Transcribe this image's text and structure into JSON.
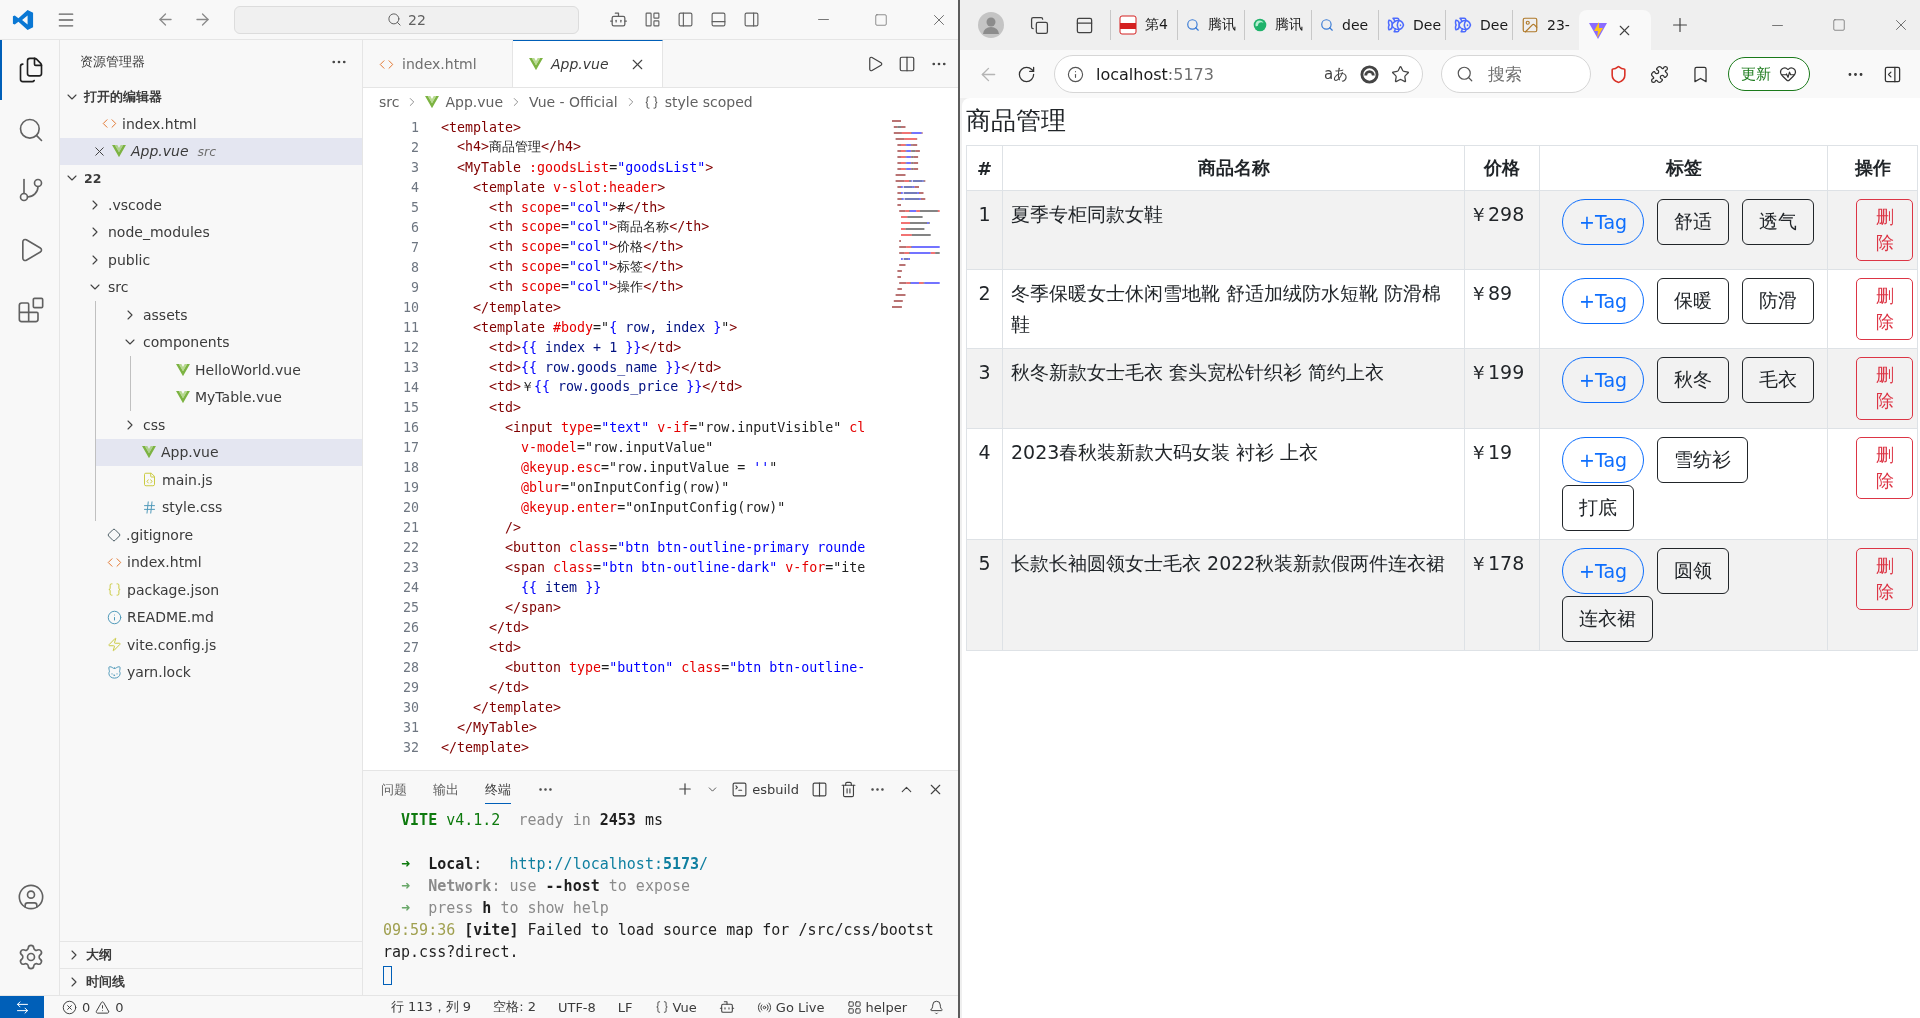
{
  "vscode": {
    "title_bar": {
      "search": "22"
    },
    "activity_bar": [
      {
        "kind": "explorer",
        "selected": true
      },
      {
        "kind": "search",
        "selected": false
      },
      {
        "kind": "source_control",
        "selected": false
      },
      {
        "kind": "run",
        "selected": false
      },
      {
        "kind": "extensions",
        "selected": false
      }
    ],
    "activity_bar_bottom": [
      {
        "kind": "account"
      },
      {
        "kind": "settings"
      }
    ],
    "sidebar": {
      "title": "资源管理器",
      "open_editors": {
        "label": "打开的编辑器",
        "expanded": true,
        "items": [
          {
            "name": "index.html",
            "kind": "html",
            "selected": false
          },
          {
            "name": "App.vue",
            "kind": "vue",
            "hint": "src",
            "selected": true
          }
        ]
      },
      "folder": {
        "label": "22",
        "expanded": true,
        "children": [
          {
            "name": ".vscode",
            "kind": "folder",
            "expanded": false,
            "selected": false
          },
          {
            "name": "node_modules",
            "kind": "folder",
            "expanded": false,
            "selected": false
          },
          {
            "name": "public",
            "kind": "folder",
            "expanded": false,
            "selected": false
          },
          {
            "name": "src",
            "kind": "folder",
            "expanded": true,
            "selected": false,
            "children": [
              {
                "name": "assets",
                "kind": "folder",
                "expanded": false,
                "selected": false
              },
              {
                "name": "components",
                "kind": "folder",
                "expanded": true,
                "selected": false,
                "children": [
                  {
                    "name": "HelloWorld.vue",
                    "kind": "vue",
                    "selected": false
                  },
                  {
                    "name": "MyTable.vue",
                    "kind": "vue",
                    "selected": false
                  }
                ]
              },
              {
                "name": "css",
                "kind": "folder",
                "expanded": false,
                "selected": false
              },
              {
                "name": "App.vue",
                "kind": "vue",
                "selected": true
              },
              {
                "name": "main.js",
                "kind": "js",
                "selected": false
              },
              {
                "name": "style.css",
                "kind": "css",
                "selected": false
              }
            ]
          },
          {
            "name": ".gitignore",
            "kind": "git",
            "selected": false
          },
          {
            "name": "index.html",
            "kind": "html",
            "selected": false
          },
          {
            "name": "package.json",
            "kind": "json",
            "selected": false
          },
          {
            "name": "README.md",
            "kind": "md",
            "selected": false
          },
          {
            "name": "vite.config.js",
            "kind": "vite",
            "selected": false
          },
          {
            "name": "yarn.lock",
            "kind": "yarn",
            "selected": false
          }
        ]
      },
      "sections": [
        {
          "label": "大纲",
          "expanded": false
        },
        {
          "label": "时间线",
          "expanded": false
        }
      ]
    },
    "tabs": [
      {
        "label": "index.html",
        "kind": "html",
        "selected": false
      },
      {
        "label": "App.vue",
        "kind": "vue",
        "selected": true
      }
    ],
    "breadcrumb": [
      {
        "label": "src",
        "kind": "plain"
      },
      {
        "label": "App.vue",
        "kind": "vue"
      },
      {
        "label": "Vue - Official",
        "kind": "plain"
      },
      {
        "label": "style scoped",
        "kind": "braces"
      }
    ],
    "code": [
      {
        "n": "1",
        "segs": [
          {
            "kind": "tag",
            "text": "<template>"
          }
        ]
      },
      {
        "n": "2",
        "segs": [
          {
            "kind": "tag",
            "text": "  <h4>"
          },
          {
            "kind": "text",
            "text": "商品管理"
          },
          {
            "kind": "tag",
            "text": "</h4>"
          }
        ]
      },
      {
        "n": "3",
        "segs": [
          {
            "kind": "tag",
            "text": "  <MyTable "
          },
          {
            "kind": "attr",
            "text": ":goodsList"
          },
          {
            "kind": "text",
            "text": "="
          },
          {
            "kind": "str",
            "text": "\"goodsList\""
          },
          {
            "kind": "tag",
            "text": ">"
          }
        ]
      },
      {
        "n": "4",
        "segs": [
          {
            "kind": "tag",
            "text": "    <template "
          },
          {
            "kind": "attr",
            "text": "v-slot:header"
          },
          {
            "kind": "tag",
            "text": ">"
          }
        ]
      },
      {
        "n": "5",
        "segs": [
          {
            "kind": "tag",
            "text": "      <th "
          },
          {
            "kind": "attr",
            "text": "scope"
          },
          {
            "kind": "text",
            "text": "="
          },
          {
            "kind": "str",
            "text": "\"col\""
          },
          {
            "kind": "tag",
            "text": ">"
          },
          {
            "kind": "text",
            "text": "#"
          },
          {
            "kind": "tag",
            "text": "</th>"
          }
        ]
      },
      {
        "n": "6",
        "segs": [
          {
            "kind": "tag",
            "text": "      <th "
          },
          {
            "kind": "attr",
            "text": "scope"
          },
          {
            "kind": "text",
            "text": "="
          },
          {
            "kind": "str",
            "text": "\"col\""
          },
          {
            "kind": "tag",
            "text": ">"
          },
          {
            "kind": "text",
            "text": "商品名称"
          },
          {
            "kind": "tag",
            "text": "</th>"
          }
        ]
      },
      {
        "n": "7",
        "segs": [
          {
            "kind": "tag",
            "text": "      <th "
          },
          {
            "kind": "attr",
            "text": "scope"
          },
          {
            "kind": "text",
            "text": "="
          },
          {
            "kind": "str",
            "text": "\"col\""
          },
          {
            "kind": "tag",
            "text": ">"
          },
          {
            "kind": "text",
            "text": "价格"
          },
          {
            "kind": "tag",
            "text": "</th>"
          }
        ]
      },
      {
        "n": "8",
        "segs": [
          {
            "kind": "tag",
            "text": "      <th "
          },
          {
            "kind": "attr",
            "text": "scope"
          },
          {
            "kind": "text",
            "text": "="
          },
          {
            "kind": "str",
            "text": "\"col\""
          },
          {
            "kind": "tag",
            "text": ">"
          },
          {
            "kind": "text",
            "text": "标签"
          },
          {
            "kind": "tag",
            "text": "</th>"
          }
        ]
      },
      {
        "n": "9",
        "segs": [
          {
            "kind": "tag",
            "text": "      <th "
          },
          {
            "kind": "attr",
            "text": "scope"
          },
          {
            "kind": "text",
            "text": "="
          },
          {
            "kind": "str",
            "text": "\"col\""
          },
          {
            "kind": "tag",
            "text": ">"
          },
          {
            "kind": "text",
            "text": "操作"
          },
          {
            "kind": "tag",
            "text": "</th>"
          }
        ]
      },
      {
        "n": "10",
        "segs": [
          {
            "kind": "tag",
            "text": "    </template>"
          }
        ]
      },
      {
        "n": "11",
        "segs": [
          {
            "kind": "tag",
            "text": "    <template "
          },
          {
            "kind": "attr",
            "text": "#body"
          },
          {
            "kind": "text",
            "text": "=\""
          },
          {
            "kind": "brace",
            "text": "{"
          },
          {
            "kind": "var",
            "text": " row, index "
          },
          {
            "kind": "brace",
            "text": "}"
          },
          {
            "kind": "text",
            "text": "\""
          },
          {
            "kind": "tag",
            "text": ">"
          }
        ]
      },
      {
        "n": "12",
        "segs": [
          {
            "kind": "tag",
            "text": "      <td>"
          },
          {
            "kind": "brace",
            "text": "{{"
          },
          {
            "kind": "var",
            "text": " index + 1 "
          },
          {
            "kind": "brace",
            "text": "}}"
          },
          {
            "kind": "tag",
            "text": "</td>"
          }
        ]
      },
      {
        "n": "13",
        "segs": [
          {
            "kind": "tag",
            "text": "      <td>"
          },
          {
            "kind": "brace",
            "text": "{{"
          },
          {
            "kind": "var",
            "text": " row.goods_name "
          },
          {
            "kind": "brace",
            "text": "}}"
          },
          {
            "kind": "tag",
            "text": "</td>"
          }
        ]
      },
      {
        "n": "14",
        "segs": [
          {
            "kind": "tag",
            "text": "      <td>"
          },
          {
            "kind": "text",
            "text": "￥"
          },
          {
            "kind": "brace",
            "text": "{{"
          },
          {
            "kind": "var",
            "text": " row.goods_price "
          },
          {
            "kind": "brace",
            "text": "}}"
          },
          {
            "kind": "tag",
            "text": "</td>"
          }
        ]
      },
      {
        "n": "15",
        "segs": [
          {
            "kind": "tag",
            "text": "      <td>"
          }
        ]
      },
      {
        "n": "16",
        "segs": [
          {
            "kind": "tag",
            "text": "        <input "
          },
          {
            "kind": "attr",
            "text": "type"
          },
          {
            "kind": "text",
            "text": "="
          },
          {
            "kind": "str",
            "text": "\"text\" "
          },
          {
            "kind": "attr",
            "text": "v-if"
          },
          {
            "kind": "text",
            "text": "=\"row.inputVisible\" "
          },
          {
            "kind": "attr",
            "text": "cl"
          }
        ]
      },
      {
        "n": "17",
        "segs": [
          {
            "kind": "attr",
            "text": "          v-model"
          },
          {
            "kind": "text",
            "text": "=\"row.inputValue\""
          }
        ]
      },
      {
        "n": "18",
        "segs": [
          {
            "kind": "attr",
            "text": "          @keyup.esc"
          },
          {
            "kind": "text",
            "text": "=\"row.inputValue = "
          },
          {
            "kind": "str",
            "text": "''"
          },
          {
            "kind": "text",
            "text": "\""
          }
        ]
      },
      {
        "n": "19",
        "segs": [
          {
            "kind": "attr",
            "text": "          @blur"
          },
          {
            "kind": "text",
            "text": "=\"onInputConfig(row)\""
          }
        ]
      },
      {
        "n": "20",
        "segs": [
          {
            "kind": "attr",
            "text": "          @keyup.enter"
          },
          {
            "kind": "text",
            "text": "=\"onInputConfig(row)\""
          }
        ]
      },
      {
        "n": "21",
        "segs": [
          {
            "kind": "tag",
            "text": "        />"
          }
        ]
      },
      {
        "n": "22",
        "segs": [
          {
            "kind": "tag",
            "text": "        <button "
          },
          {
            "kind": "attr",
            "text": "class"
          },
          {
            "kind": "text",
            "text": "="
          },
          {
            "kind": "str",
            "text": "\"btn btn-outline-primary rounde"
          }
        ]
      },
      {
        "n": "23",
        "segs": [
          {
            "kind": "tag",
            "text": "        <span "
          },
          {
            "kind": "attr",
            "text": "class"
          },
          {
            "kind": "text",
            "text": "="
          },
          {
            "kind": "str",
            "text": "\"btn btn-outline-dark\" "
          },
          {
            "kind": "attr",
            "text": "v-for"
          },
          {
            "kind": "text",
            "text": "=\"ite"
          }
        ]
      },
      {
        "n": "24",
        "segs": [
          {
            "kind": "brace",
            "text": "          {{"
          },
          {
            "kind": "var",
            "text": " item "
          },
          {
            "kind": "brace",
            "text": "}}"
          }
        ]
      },
      {
        "n": "25",
        "segs": [
          {
            "kind": "tag",
            "text": "        </span>"
          }
        ]
      },
      {
        "n": "26",
        "segs": [
          {
            "kind": "tag",
            "text": "      </td>"
          }
        ]
      },
      {
        "n": "27",
        "segs": [
          {
            "kind": "tag",
            "text": "      <td>"
          }
        ]
      },
      {
        "n": "28",
        "segs": [
          {
            "kind": "tag",
            "text": "        <button "
          },
          {
            "kind": "attr",
            "text": "type"
          },
          {
            "kind": "text",
            "text": "="
          },
          {
            "kind": "str",
            "text": "\"button\" "
          },
          {
            "kind": "attr",
            "text": "class"
          },
          {
            "kind": "text",
            "text": "="
          },
          {
            "kind": "str",
            "text": "\"btn btn-outline-"
          }
        ]
      },
      {
        "n": "29",
        "segs": [
          {
            "kind": "tag",
            "text": "      </td>"
          }
        ]
      },
      {
        "n": "30",
        "segs": [
          {
            "kind": "tag",
            "text": "    </template>"
          }
        ]
      },
      {
        "n": "31",
        "segs": [
          {
            "kind": "tag",
            "text": "  </MyTable>"
          }
        ]
      },
      {
        "n": "32",
        "segs": [
          {
            "kind": "tag",
            "text": "</template>"
          }
        ]
      }
    ],
    "panel": {
      "tabs": [
        {
          "label": "问题",
          "selected": false
        },
        {
          "label": "输出",
          "selected": false
        },
        {
          "label": "终端",
          "selected": true
        }
      ],
      "terminal_name": "esbuild",
      "lines": [
        {
          "segs": [
            {
              "kind": "vite",
              "text": "  VITE"
            },
            {
              "kind": "green",
              "text": " v4.1.2"
            },
            {
              "kind": "dim",
              "text": "  ready in "
            },
            {
              "kind": "bold",
              "text": "2453"
            },
            {
              "kind": "text",
              "text": " ms"
            }
          ]
        },
        {
          "gap_before": true,
          "segs": [
            {
              "kind": "green",
              "text": "  ➜  "
            },
            {
              "kind": "bold",
              "text": "Local"
            },
            {
              "kind": "text",
              "text": ":   "
            },
            {
              "kind": "link",
              "text": "http://localhost:"
            },
            {
              "kind": "linkbold",
              "text": "5173"
            },
            {
              "kind": "link",
              "text": "/"
            }
          ]
        },
        {
          "segs": [
            {
              "kind": "lightgreen",
              "text": "  ➜  "
            },
            {
              "kind": "dimbold",
              "text": "Network"
            },
            {
              "kind": "dim",
              "text": ": use "
            },
            {
              "kind": "bold",
              "text": "--host"
            },
            {
              "kind": "dim",
              "text": " to expose"
            }
          ]
        },
        {
          "segs": [
            {
              "kind": "lightgreen",
              "text": "  ➜  "
            },
            {
              "kind": "dim",
              "text": "press "
            },
            {
              "kind": "bold",
              "text": "h"
            },
            {
              "kind": "dim",
              "text": " to show help"
            }
          ]
        },
        {
          "segs": [
            {
              "kind": "time",
              "text": "09:59:36 "
            },
            {
              "kind": "bold",
              "text": "[vite]"
            },
            {
              "kind": "text",
              "text": " Failed to load source map for /src/css/bootst"
            }
          ]
        },
        {
          "segs": [
            {
              "kind": "text",
              "text": "rap.css?direct."
            }
          ]
        }
      ]
    },
    "status_bar": {
      "errors": "0",
      "warnings": "0",
      "items": [
        {
          "kind": "plain",
          "label": "行 113，列 9"
        },
        {
          "kind": "plain",
          "label": "空格: 2"
        },
        {
          "kind": "plain",
          "label": "UTF-8"
        },
        {
          "kind": "plain",
          "label": "LF"
        },
        {
          "kind": "language",
          "label": "Vue"
        },
        {
          "kind": "copilot"
        },
        {
          "kind": "live",
          "label": "Go Live"
        },
        {
          "kind": "helper",
          "label": "helper"
        },
        {
          "kind": "bell"
        }
      ]
    }
  },
  "browser": {
    "tabs": [
      {
        "label": "第4",
        "kind": "pdf",
        "selected": false
      },
      {
        "label": "腾讯",
        "kind": "search",
        "selected": false
      },
      {
        "label": "腾讯",
        "kind": "orb",
        "selected": false
      },
      {
        "label": "dee",
        "kind": "search",
        "selected": false
      },
      {
        "label": "Dee",
        "kind": "whale",
        "selected": false
      },
      {
        "label": "Dee",
        "kind": "whale",
        "selected": false
      },
      {
        "label": "23-",
        "kind": "image",
        "selected": false
      },
      {
        "kind": "vite",
        "selected": true
      }
    ],
    "address": {
      "host": "localhost",
      "port": ":5173",
      "reader": "aあ"
    },
    "search": {
      "placeholder": "搜索"
    },
    "update_button": "更新",
    "page": {
      "title": "商品管理",
      "columns": [
        "#",
        "商品名称",
        "价格",
        "标签",
        "操作"
      ],
      "rows": [
        {
          "index": "1",
          "name": "夏季专柜同款女鞋",
          "price": "￥298",
          "add_label": "+Tag",
          "tags": [
            "舒适",
            "透气"
          ],
          "delete_label": "删除"
        },
        {
          "index": "2",
          "name": "冬季保暖女士休闲雪地靴 舒适加绒防水短靴 防滑棉鞋",
          "price": "￥89",
          "add_label": "+Tag",
          "tags": [
            "保暖",
            "防滑"
          ],
          "delete_label": "删除"
        },
        {
          "index": "3",
          "name": "秋冬新款女士毛衣 套头宽松针织衫 简约上衣",
          "price": "￥199",
          "add_label": "+Tag",
          "tags": [
            "秋冬",
            "毛衣"
          ],
          "delete_label": "删除"
        },
        {
          "index": "4",
          "name": "2023春秋装新款大码女装 衬衫 上衣",
          "price": "￥19",
          "add_label": "+Tag",
          "tags": [
            "雪纺衫",
            "打底"
          ],
          "delete_label": "删除"
        },
        {
          "index": "5",
          "name": "长款长袖圆领女士毛衣 2022秋装新款假两件连衣裙",
          "price": "￥178",
          "add_label": "+Tag",
          "tags": [
            "圆领",
            "连衣裙"
          ],
          "delete_label": "删除"
        }
      ]
    }
  }
}
